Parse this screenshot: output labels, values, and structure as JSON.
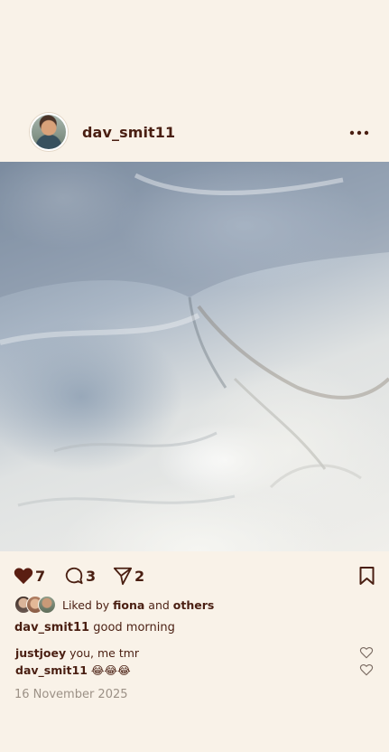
{
  "post": {
    "username": "dav_smit11",
    "avatar_icon": "user-avatar",
    "menu_icon": "more-horizontal-icon",
    "photo_description_icon": "post-photo"
  },
  "actions": {
    "like_count": "7",
    "comment_count": "3",
    "share_count": "2"
  },
  "liked_by": {
    "prefix": "Liked by ",
    "user": "fiona",
    "middle": " and ",
    "others": "others"
  },
  "caption": {
    "user": "dav_smit11",
    "text": " good morning"
  },
  "comments": [
    {
      "user": "justjoey",
      "text": " you, me tmr"
    },
    {
      "user": "dav_smit11",
      "text": " 😂😂😂"
    }
  ],
  "date": "16 November 2025",
  "colors": {
    "background": "#f9f2e8",
    "accent": "#4a1f12",
    "muted": "#9c9186"
  }
}
